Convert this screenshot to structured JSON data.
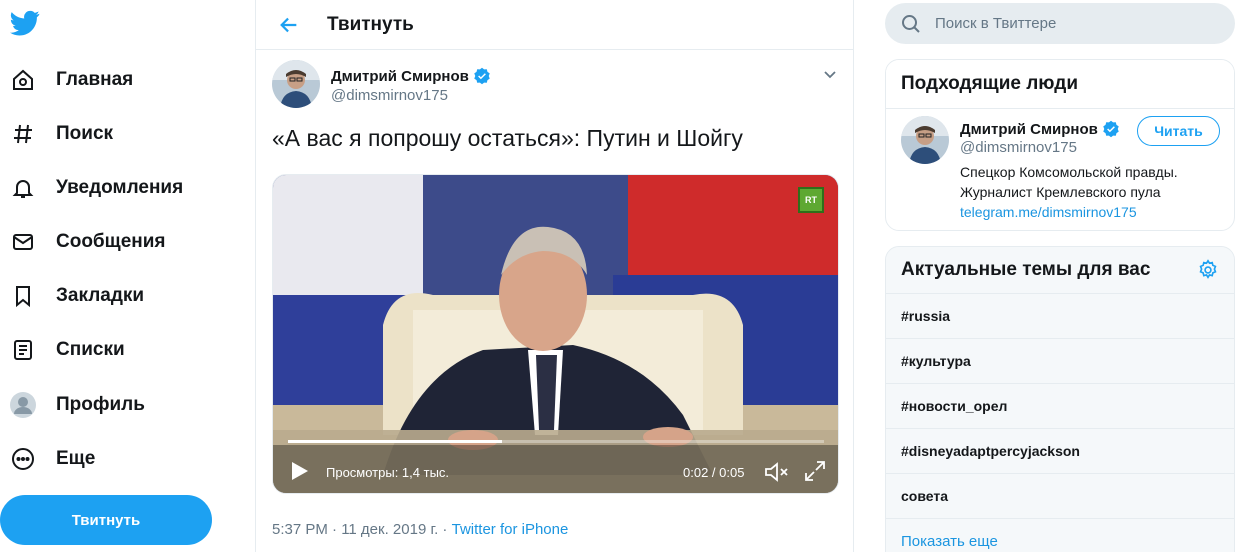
{
  "colors": {
    "accent": "#1da1f2",
    "link": "#1b95e0",
    "muted": "#657786",
    "text": "#14171a",
    "border": "#e6ecf0"
  },
  "nav": {
    "logo_icon": "twitter-bird-icon",
    "items": [
      {
        "label": "Главная",
        "icon": "home-icon"
      },
      {
        "label": "Поиск",
        "icon": "hashtag-icon"
      },
      {
        "label": "Уведомления",
        "icon": "bell-icon"
      },
      {
        "label": "Сообщения",
        "icon": "envelope-icon"
      },
      {
        "label": "Закладки",
        "icon": "bookmark-icon"
      },
      {
        "label": "Списки",
        "icon": "list-icon"
      },
      {
        "label": "Профиль",
        "icon": "profile-icon"
      },
      {
        "label": "Еще",
        "icon": "more-icon"
      }
    ],
    "tweet_button": "Твитнуть"
  },
  "header": {
    "title": "Твитнуть"
  },
  "tweet": {
    "author_name": "Дмитрий Смирнов",
    "author_handle": "@dimsmirnov175",
    "text": "«А вас я попрошу остаться»: Путин и Шойгу",
    "video": {
      "badge": "RT",
      "views": "Просмотры: 1,4 тыс.",
      "time": "0:02 / 0:05",
      "progress": 0.4
    },
    "timestamp": "5:37 PM · 11 дек. 2019 г. · ",
    "source": "Twitter for iPhone"
  },
  "search": {
    "placeholder": "Поиск в Твиттере"
  },
  "suggested": {
    "title": "Подходящие люди",
    "person": {
      "name": "Дмитрий Смирнов",
      "handle": "@dimsmirnov175",
      "follow_label": "Читать",
      "bio_line1": "Спецкор Комсомольской правды.",
      "bio_line2": "Журналист Кремлевского пула",
      "bio_link": "telegram.me/dimsmirnov175"
    }
  },
  "trends": {
    "title": "Актуальные темы для вас",
    "items": [
      "#russia",
      "#культура",
      "#новости_орел",
      "#disneyadaptpercyjackson",
      "совета"
    ],
    "show_more": "Показать еще"
  }
}
